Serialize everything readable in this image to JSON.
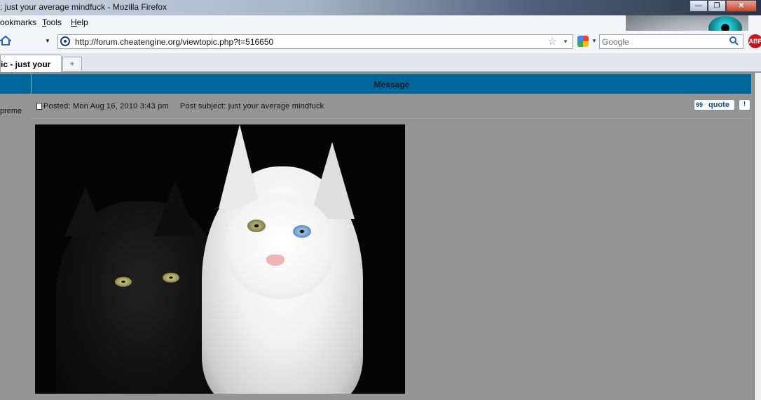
{
  "window": {
    "title": ": just your average mindfuck - Mozilla Firefox",
    "minimize_glyph": "—",
    "restore_glyph": "❐",
    "close_glyph": "✕"
  },
  "menu": {
    "bookmarks": "ookmarks",
    "tools_accel": "T",
    "tools_rest": "ools",
    "help_accel": "H",
    "help_rest": "elp"
  },
  "nav": {
    "url": "http://forum.cheatengine.org/viewtopic.php?t=516650",
    "search_placeholder": "Google",
    "abp_label": "ABP"
  },
  "tabs": [
    {
      "label": "ic - just your"
    }
  ],
  "newtab_glyph": "+",
  "post": {
    "header_label": "Message",
    "author_fragment": "preme",
    "posted": "Posted: Mon Aug 16, 2010 3:43 pm",
    "subject": "Post subject: just your average mindfuck",
    "quote_label": "quote",
    "quote_icon_glyph": "99",
    "info_label": "!"
  },
  "icons": {
    "home": "home-icon",
    "site": "site-favicon",
    "star": "bookmark-star-icon",
    "search": "magnifier-icon",
    "adblock": "adblock-icon",
    "post": "post-icon"
  },
  "colors": {
    "forum_header": "#006699",
    "content_bg": "#949494",
    "quote_text": "#1a4f85"
  }
}
